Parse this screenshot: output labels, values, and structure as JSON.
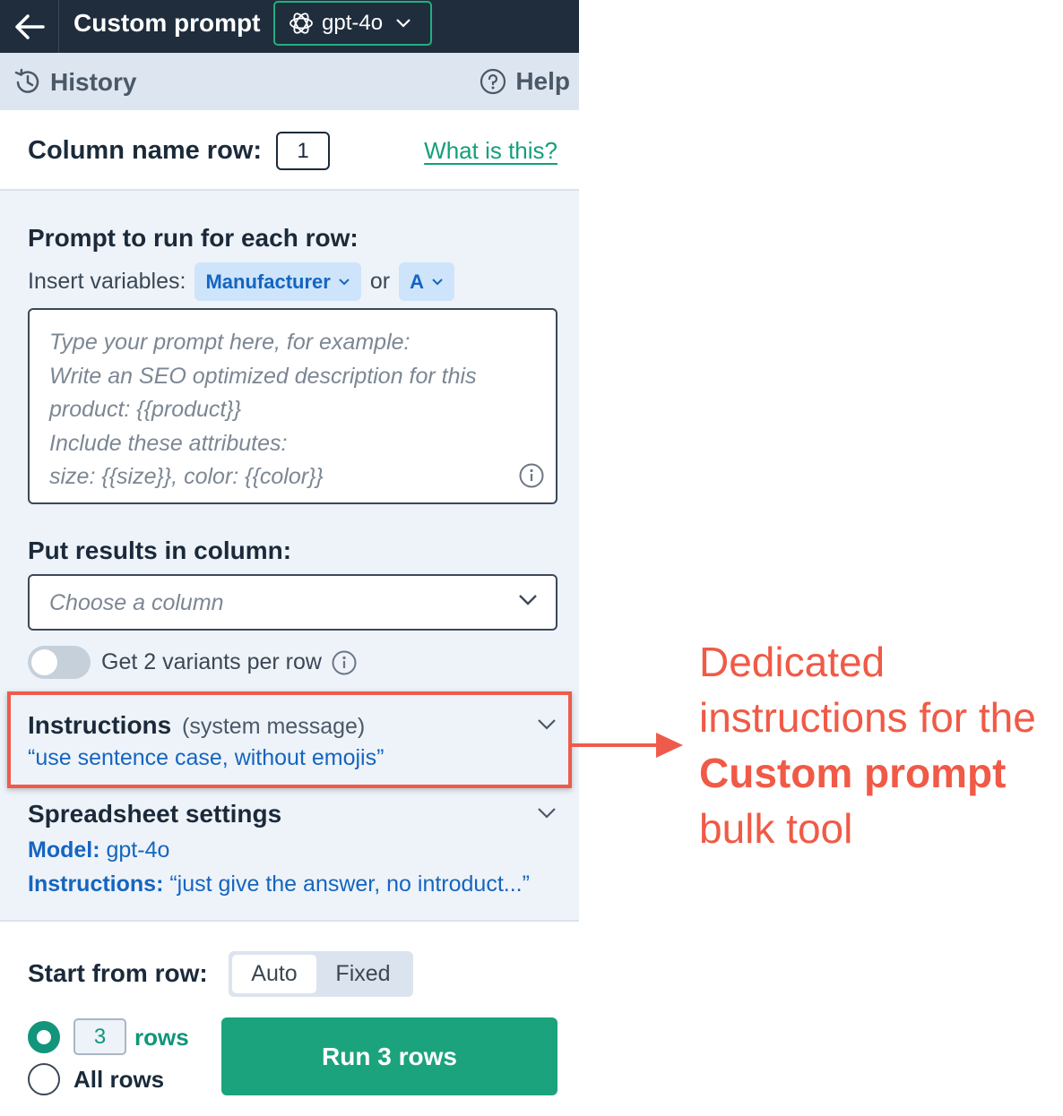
{
  "topbar": {
    "back_icon": "arrow-left-icon",
    "title": "Custom prompt",
    "model": {
      "icon": "openai-icon",
      "label": "gpt-4o",
      "chevron_icon": "chevron-down-icon"
    }
  },
  "subbar": {
    "history": {
      "icon": "history-icon",
      "label": "History"
    },
    "help": {
      "icon": "question-circle-icon",
      "label": "Help"
    }
  },
  "column_name_row": {
    "label": "Column name row:",
    "value": "1",
    "link": "What is this?"
  },
  "prompt_section": {
    "title": "Prompt to run for each row:",
    "insert_label": "Insert variables:",
    "variable_chip": "Manufacturer",
    "or_label": "or",
    "column_chip": "A",
    "placeholder": "Type your prompt here, for example:\nWrite an SEO optimized description for this product: {{product}}\nInclude these attributes:\nsize: {{size}}, color: {{color}}"
  },
  "results_section": {
    "title": "Put results in column:",
    "placeholder": "Choose a column"
  },
  "variants_toggle": {
    "label": "Get 2 variants per row",
    "on": false
  },
  "instructions": {
    "title": "Instructions",
    "subtitle": "(system message)",
    "value": "“use sentence case, without emojis”"
  },
  "spreadsheet_settings": {
    "title": "Spreadsheet settings",
    "model_label": "Model:",
    "model_value": " gpt-4o",
    "instructions_label": "Instructions:",
    "instructions_value": " “just give the answer, no introduct...”"
  },
  "start_row": {
    "label": "Start from row:",
    "options": [
      "Auto",
      "Fixed"
    ],
    "selected": "Auto"
  },
  "rows_option": {
    "count": "3",
    "rows_label": "rows",
    "all_rows_label": "All rows",
    "selected": "rows"
  },
  "run_button": {
    "label": "Run 3 rows"
  },
  "annotation": {
    "line1": "Dedicated",
    "line2": "instructions for the",
    "line3_bold": "Custom prompt",
    "line4": "bulk tool"
  },
  "colors": {
    "topbar": "#1f2d3d",
    "accent": "#1ba37d",
    "link_blue": "#1565c0",
    "annotation_red": "#f05a46"
  }
}
